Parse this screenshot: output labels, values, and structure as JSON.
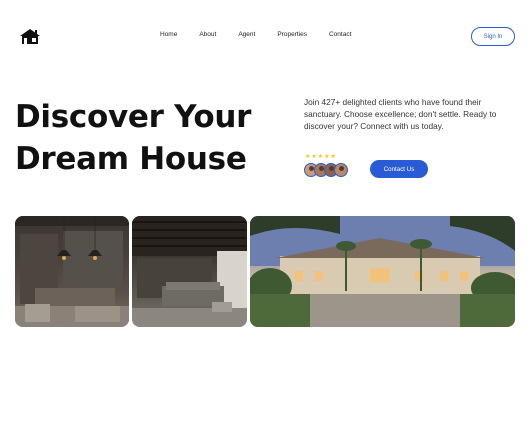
{
  "nav": {
    "links": [
      "Home",
      "About",
      "Agent",
      "Properties",
      "Contact"
    ],
    "signin": "Sign In"
  },
  "hero": {
    "title_line1": "Discover Your",
    "title_line2": "Dream House",
    "description": "Join 427+ delighted clients who have found their sanctuary. Choose excellence; don't settle. Ready to discover your? Connect with us today.",
    "stars": "★★★★★",
    "contact_button": "Contact Us"
  },
  "images": [
    {
      "name": "interior-kitchen-photo"
    },
    {
      "name": "interior-living-room-photo"
    },
    {
      "name": "luxury-house-exterior-photo"
    }
  ],
  "colors": {
    "accent": "#2a5bd7",
    "star": "#f5c518"
  }
}
